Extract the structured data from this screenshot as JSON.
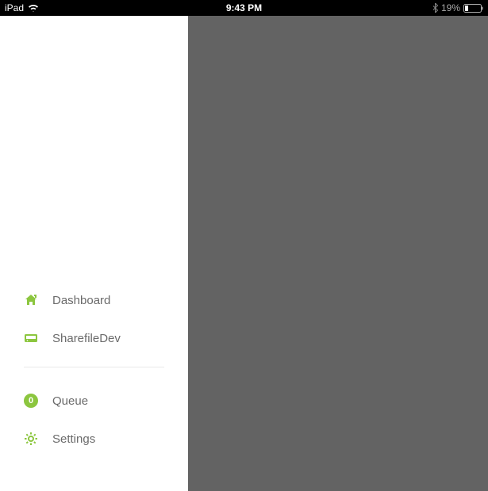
{
  "status_bar": {
    "device": "iPad",
    "time": "9:43 PM",
    "battery_percent": "19%"
  },
  "sidebar": {
    "items": [
      {
        "label": "Dashboard"
      },
      {
        "label": "SharefileDev"
      }
    ],
    "secondary": [
      {
        "label": "Queue",
        "badge": "0"
      },
      {
        "label": "Settings"
      }
    ]
  },
  "colors": {
    "accent": "#8cc63f"
  }
}
